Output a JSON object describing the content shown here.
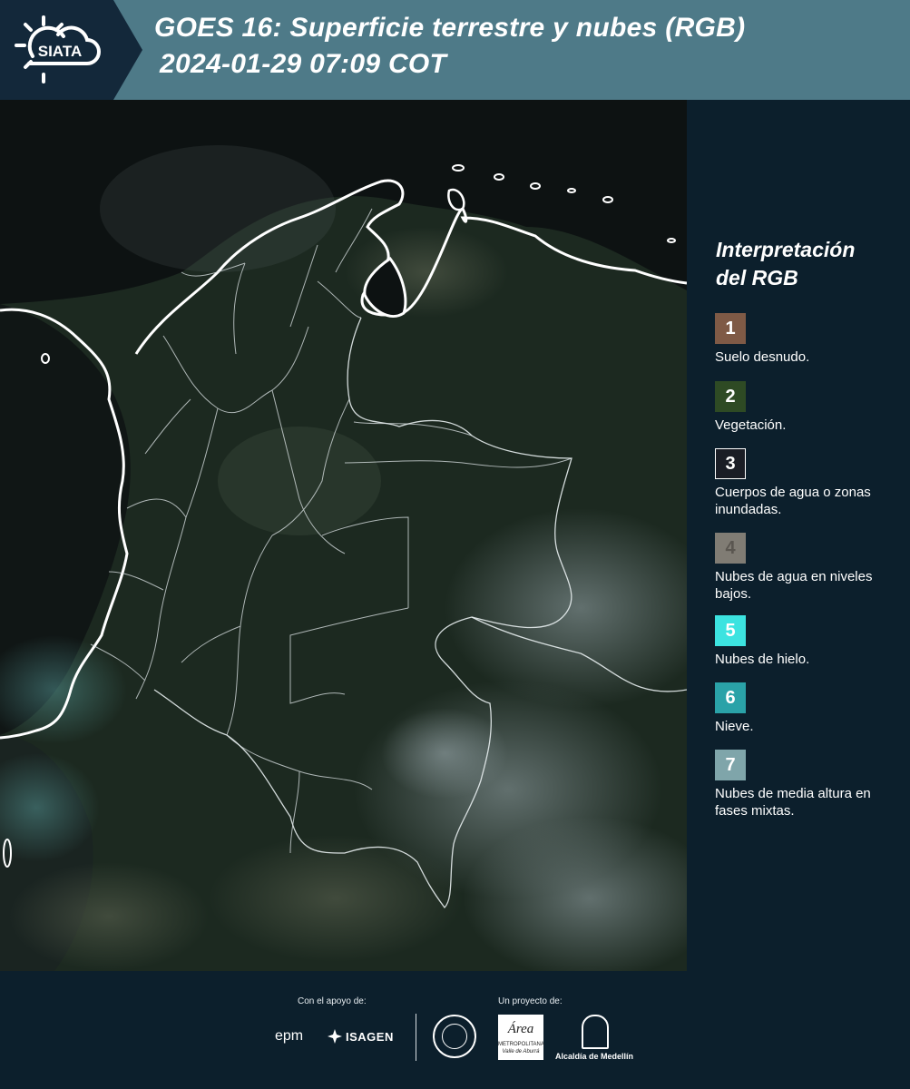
{
  "header": {
    "logo_text": "SIATA",
    "title_line1": "GOES 16: Superficie terrestre y nubes (RGB)",
    "title_line2": "2024-01-29 07:09 COT"
  },
  "legend": {
    "title_line1": "Interpretación",
    "title_line2": "del RGB",
    "items": [
      {
        "number": "1",
        "label": "Suelo desnudo.",
        "color": "#7f5a46"
      },
      {
        "number": "2",
        "label": "Vegetación.",
        "color": "#2e4a24"
      },
      {
        "number": "3",
        "label": "Cuerpos de agua o zonas inundadas.",
        "color": "#1a1d25"
      },
      {
        "number": "4",
        "label": "Nubes de agua en niveles bajos.",
        "color": "#807c74"
      },
      {
        "number": "5",
        "label": "Nubes de hielo.",
        "color": "#3ce3e0"
      },
      {
        "number": "6",
        "label": "Nieve.",
        "color": "#2aa2a8"
      },
      {
        "number": "7",
        "label": "Nubes de media altura en fases mixtas.",
        "color": "#7fa5aa"
      }
    ]
  },
  "footer": {
    "support_label": "Con el apoyo de:",
    "project_label": "Un proyecto de:",
    "sponsor_epm": "epm",
    "sponsor_isagen": "ISAGEN",
    "area_line1": "Área",
    "area_line2": "METROPOLITANA",
    "area_line3": "Valle de Aburrá",
    "alcaldia": "Alcaldía de Medellín"
  },
  "colors": {
    "header_bar": "#4e7a88",
    "header_dark": "#13283a",
    "background": "#0c1f2c",
    "vegetation": "#24331f",
    "ocean": "#0d1313"
  }
}
